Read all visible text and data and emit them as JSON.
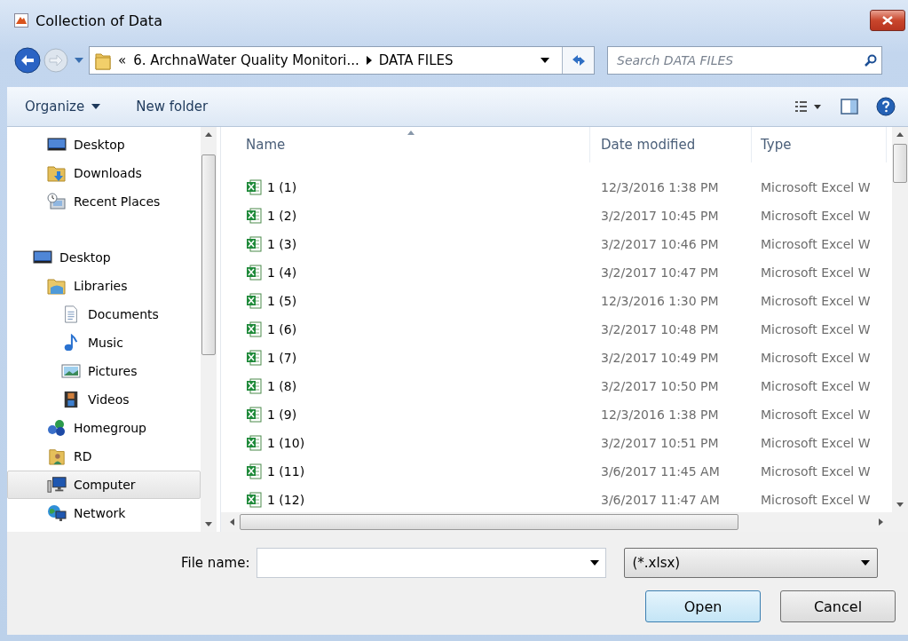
{
  "window": {
    "title": "Collection of Data"
  },
  "address_bar": {
    "overflow": "«",
    "segments": [
      "6. ArchnaWater Quality Monitori...",
      "DATA FILES"
    ]
  },
  "search": {
    "placeholder": "Search DATA FILES"
  },
  "toolbar": {
    "buttons": [
      "Organize",
      "New folder"
    ]
  },
  "sidebar": {
    "sections": [
      {
        "items": [
          {
            "label": "Desktop",
            "kind": "desktop",
            "selected": false
          },
          {
            "label": "Downloads",
            "kind": "downloads",
            "selected": false
          },
          {
            "label": "Recent Places",
            "kind": "recent",
            "selected": false
          }
        ]
      },
      {
        "items": [
          {
            "label": "Desktop",
            "kind": "desktop",
            "selected": false,
            "children": [
              {
                "label": "Libraries",
                "kind": "libraries",
                "selected": false,
                "children": [
                  {
                    "label": "Documents",
                    "kind": "documents",
                    "selected": false
                  },
                  {
                    "label": "Music",
                    "kind": "music",
                    "selected": false
                  },
                  {
                    "label": "Pictures",
                    "kind": "pictures",
                    "selected": false
                  },
                  {
                    "label": "Videos",
                    "kind": "videos",
                    "selected": false
                  }
                ]
              },
              {
                "label": "Homegroup",
                "kind": "homegroup",
                "selected": false
              },
              {
                "label": "RD",
                "kind": "user",
                "selected": false
              },
              {
                "label": "Computer",
                "kind": "computer",
                "selected": true
              },
              {
                "label": "Network",
                "kind": "network",
                "selected": false
              }
            ]
          }
        ]
      }
    ]
  },
  "table": {
    "columns": [
      "Name",
      "Date modified",
      "Type"
    ],
    "rows": [
      {
        "name": "1 (1)",
        "date": "12/3/2016 1:38 PM",
        "type": "Microsoft Excel W"
      },
      {
        "name": "1 (2)",
        "date": "3/2/2017 10:45 PM",
        "type": "Microsoft Excel W"
      },
      {
        "name": "1 (3)",
        "date": "3/2/2017 10:46 PM",
        "type": "Microsoft Excel W"
      },
      {
        "name": "1 (4)",
        "date": "3/2/2017 10:47 PM",
        "type": "Microsoft Excel W"
      },
      {
        "name": "1 (5)",
        "date": "12/3/2016 1:30 PM",
        "type": "Microsoft Excel W"
      },
      {
        "name": "1 (6)",
        "date": "3/2/2017 10:48 PM",
        "type": "Microsoft Excel W"
      },
      {
        "name": "1 (7)",
        "date": "3/2/2017 10:49 PM",
        "type": "Microsoft Excel W"
      },
      {
        "name": "1 (8)",
        "date": "3/2/2017 10:50 PM",
        "type": "Microsoft Excel W"
      },
      {
        "name": "1 (9)",
        "date": "12/3/2016 1:38 PM",
        "type": "Microsoft Excel W"
      },
      {
        "name": "1 (10)",
        "date": "3/2/2017 10:51 PM",
        "type": "Microsoft Excel W"
      },
      {
        "name": "1 (11)",
        "date": "3/6/2017 11:45 AM",
        "type": "Microsoft Excel W"
      },
      {
        "name": "1 (12)",
        "date": "3/6/2017 11:47 AM",
        "type": "Microsoft Excel W"
      }
    ]
  },
  "footer": {
    "file_name_label": "File name:",
    "file_type": "(*.xlsx)",
    "buttons": [
      "Open",
      "Cancel"
    ]
  }
}
